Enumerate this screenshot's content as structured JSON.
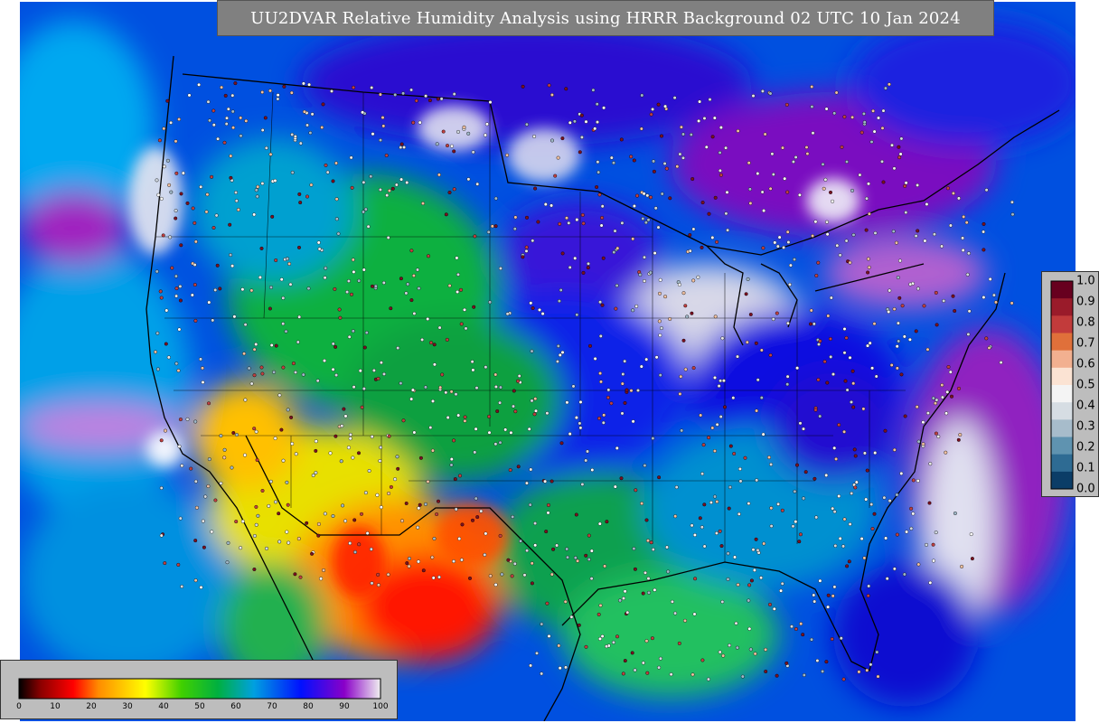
{
  "title": "UU2DVAR Relative Humidity Analysis using HRRR Background 02 UTC 10 Jan 2024",
  "rh_colorbar": {
    "ticks": [
      "0",
      "10",
      "20",
      "30",
      "40",
      "50",
      "60",
      "70",
      "80",
      "90",
      "100"
    ],
    "colors": [
      "#000000",
      "#8b0000",
      "#ff0000",
      "#ff8c00",
      "#ffff00",
      "#00c000",
      "#009a4a",
      "#00a6ff",
      "#0000ff",
      "#8a00c8",
      "#e0e0e0"
    ]
  },
  "obs_colorbar": {
    "ticks": [
      "1.0",
      "0.9",
      "0.8",
      "0.7",
      "0.6",
      "0.5",
      "0.4",
      "0.3",
      "0.2",
      "0.1",
      "0.0"
    ],
    "colors": [
      "#67001f",
      "#9a1b2a",
      "#c23b3b",
      "#e0703a",
      "#f2b090",
      "#fbe3d3",
      "#f4f4f4",
      "#d6dde3",
      "#a7bccb",
      "#5f93b0",
      "#2e6b93",
      "#0b3d67"
    ]
  }
}
